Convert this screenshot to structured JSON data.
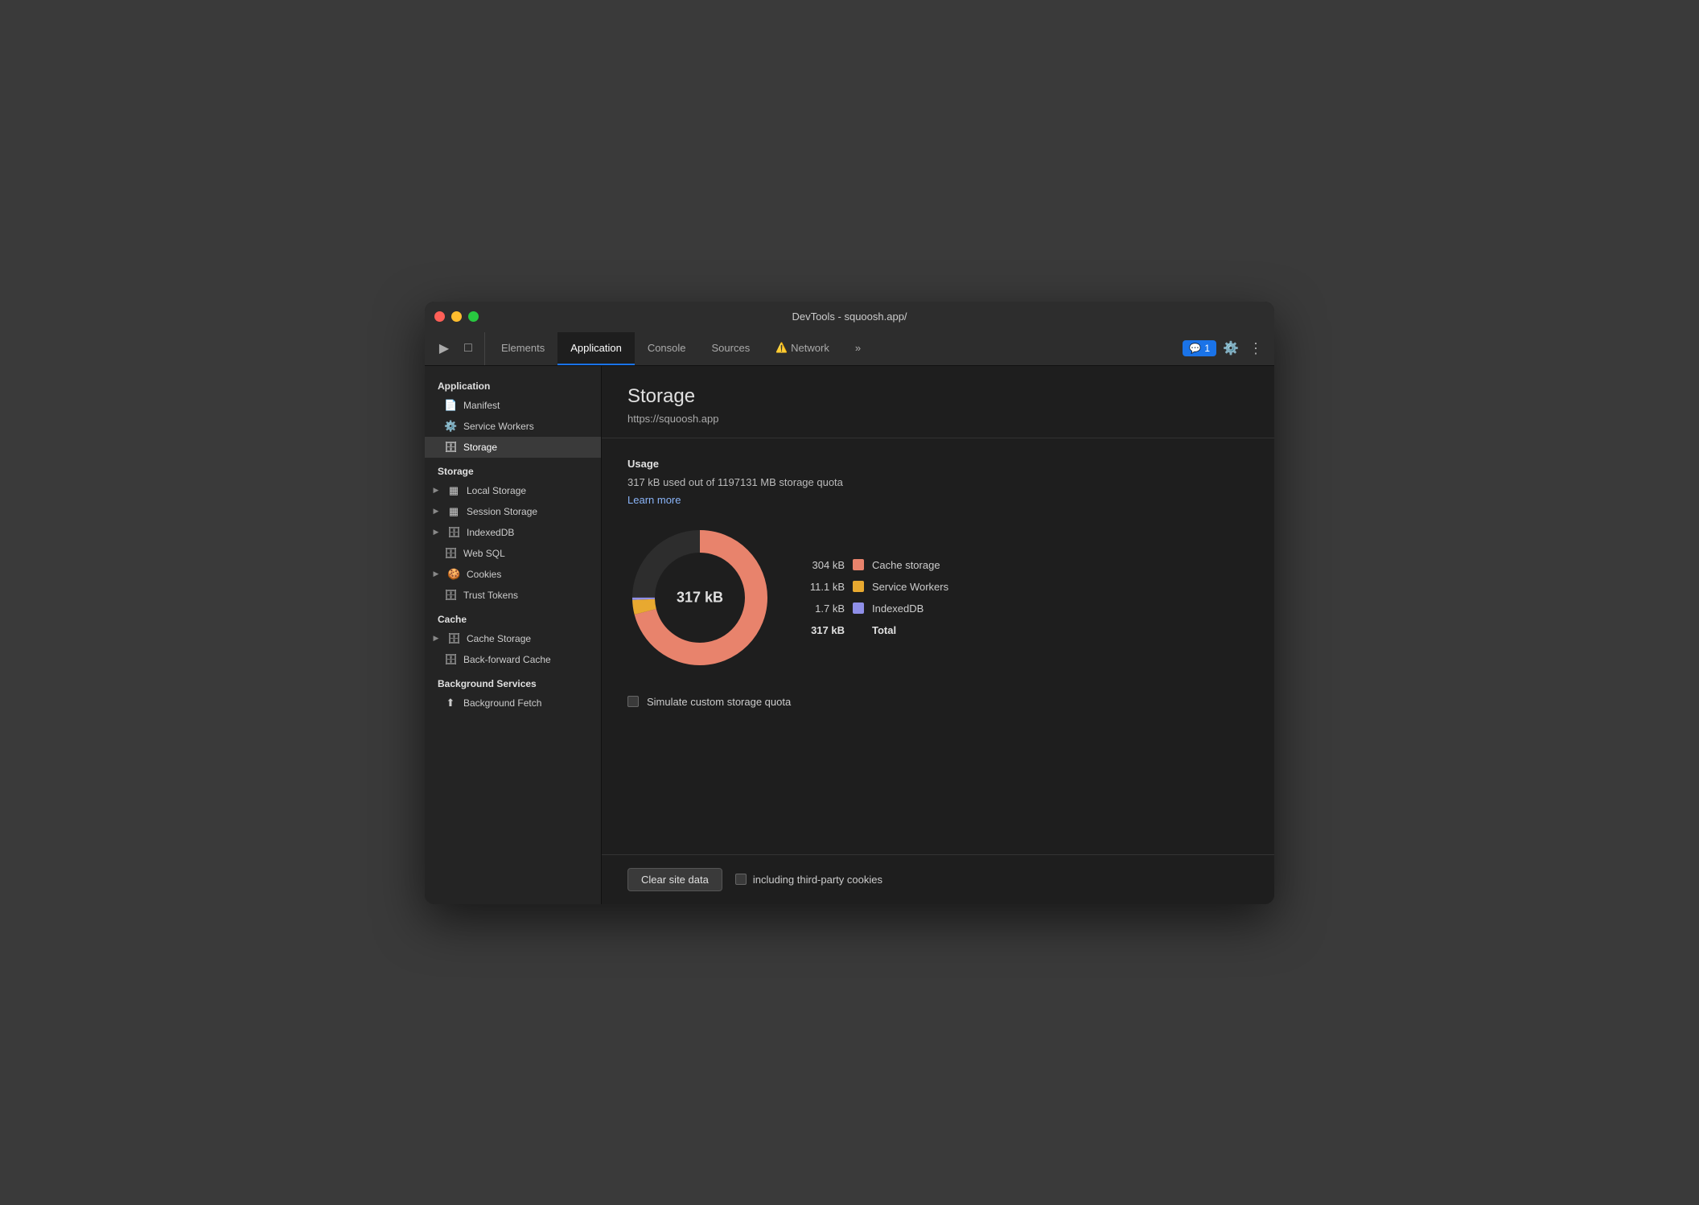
{
  "window": {
    "title": "DevTools - squoosh.app/"
  },
  "tabs": [
    {
      "id": "elements",
      "label": "Elements",
      "active": false
    },
    {
      "id": "application",
      "label": "Application",
      "active": true
    },
    {
      "id": "console",
      "label": "Console",
      "active": false
    },
    {
      "id": "sources",
      "label": "Sources",
      "active": false
    },
    {
      "id": "network",
      "label": "Network",
      "active": false,
      "warning": "⚠️"
    }
  ],
  "tab_more": "»",
  "tab_badge": "1",
  "sidebar": {
    "sections": [
      {
        "label": "Application",
        "items": [
          {
            "id": "manifest",
            "label": "Manifest",
            "icon": "📄",
            "indent": true
          },
          {
            "id": "service-workers",
            "label": "Service Workers",
            "icon": "⚙️",
            "indent": true
          },
          {
            "id": "storage",
            "label": "Storage",
            "icon": "🗄",
            "indent": true,
            "active": true
          }
        ]
      },
      {
        "label": "Storage",
        "items": [
          {
            "id": "local-storage",
            "label": "Local Storage",
            "icon": "▦",
            "arrow": true
          },
          {
            "id": "session-storage",
            "label": "Session Storage",
            "icon": "▦",
            "arrow": true
          },
          {
            "id": "indexeddb",
            "label": "IndexedDB",
            "icon": "🗄",
            "arrow": true
          },
          {
            "id": "web-sql",
            "label": "Web SQL",
            "icon": "🗄",
            "indent": true
          },
          {
            "id": "cookies",
            "label": "Cookies",
            "icon": "🍪",
            "arrow": true
          },
          {
            "id": "trust-tokens",
            "label": "Trust Tokens",
            "icon": "🗄",
            "indent": true
          }
        ]
      },
      {
        "label": "Cache",
        "items": [
          {
            "id": "cache-storage",
            "label": "Cache Storage",
            "icon": "🗄",
            "arrow": true
          },
          {
            "id": "back-forward-cache",
            "label": "Back-forward Cache",
            "icon": "🗄",
            "indent": true
          }
        ]
      },
      {
        "label": "Background Services",
        "items": [
          {
            "id": "background-fetch",
            "label": "Background Fetch",
            "icon": "⬆",
            "indent": true
          }
        ]
      }
    ]
  },
  "content": {
    "title": "Storage",
    "url": "https://squoosh.app",
    "usage_title": "Usage",
    "usage_text": "317 kB used out of 1197131 MB storage quota",
    "learn_more": "Learn more",
    "donut_label": "317 kB",
    "legend": [
      {
        "value": "304 kB",
        "color": "#e8836c",
        "name": "Cache storage"
      },
      {
        "value": "11.1 kB",
        "color": "#e8a930",
        "name": "Service Workers"
      },
      {
        "value": "1.7 kB",
        "color": "#8f8fe8",
        "name": "IndexedDB"
      }
    ],
    "total_value": "317 kB",
    "total_label": "Total",
    "simulate_label": "Simulate custom storage quota",
    "clear_btn": "Clear site data",
    "third_party_label": "including third-party cookies"
  },
  "colors": {
    "cache_storage": "#e8836c",
    "service_workers": "#e8a930",
    "indexeddb": "#8f8fe8",
    "donut_bg": "#2d2d2d"
  }
}
